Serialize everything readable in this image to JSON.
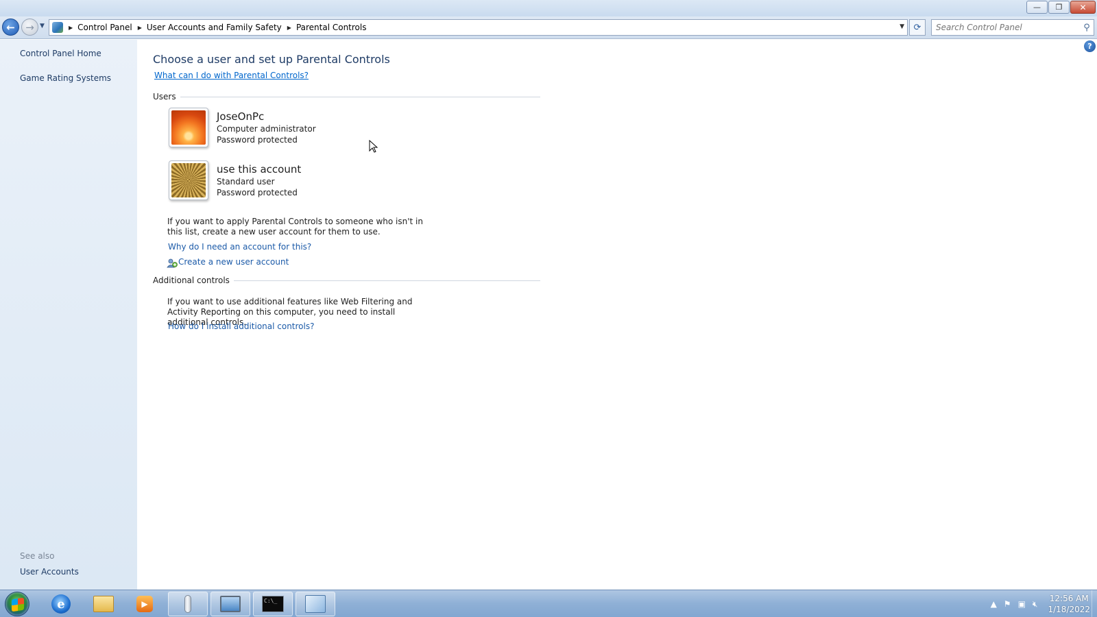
{
  "window": {
    "minimize_glyph": "—",
    "maximize_glyph": "❐",
    "close_glyph": "✕"
  },
  "nav": {
    "breadcrumbs": [
      "Control Panel",
      "User Accounts and Family Safety",
      "Parental Controls"
    ],
    "search_placeholder": "Search Control Panel"
  },
  "sidebar": {
    "items": [
      "Control Panel Home",
      "Game Rating Systems"
    ],
    "see_also_heading": "See also",
    "see_also_items": [
      "User Accounts"
    ]
  },
  "main": {
    "title": "Choose a user and set up Parental Controls",
    "help_link": "What can I do with Parental Controls?",
    "users_heading": "Users",
    "users": [
      {
        "name": "JoseOnPc",
        "role": "Computer administrator",
        "status": "Password protected",
        "picture": "orange-flower"
      },
      {
        "name": "use this account",
        "role": "Standard user",
        "status": "Password protected",
        "picture": "golden-pattern"
      }
    ],
    "new_account_text": "If you want to apply Parental Controls to someone who isn't in this list, create a new user account for them to use.",
    "why_account_link": "Why do I need an account for this?",
    "create_account_link": "Create a new user account",
    "additional_heading": "Additional controls",
    "additional_text": "If you want to use additional features like Web Filtering and Activity Reporting on this computer, you need to install additional controls.",
    "install_link": "How do I install additional controls?"
  },
  "taskbar": {
    "apps": [
      "start-orb",
      "internet-explorer",
      "windows-explorer",
      "media-player",
      "speech-recognition",
      "remote-desktop",
      "command-prompt",
      "control-panel"
    ],
    "clock_time": "12:56 AM",
    "clock_date": "1/18/2022"
  }
}
